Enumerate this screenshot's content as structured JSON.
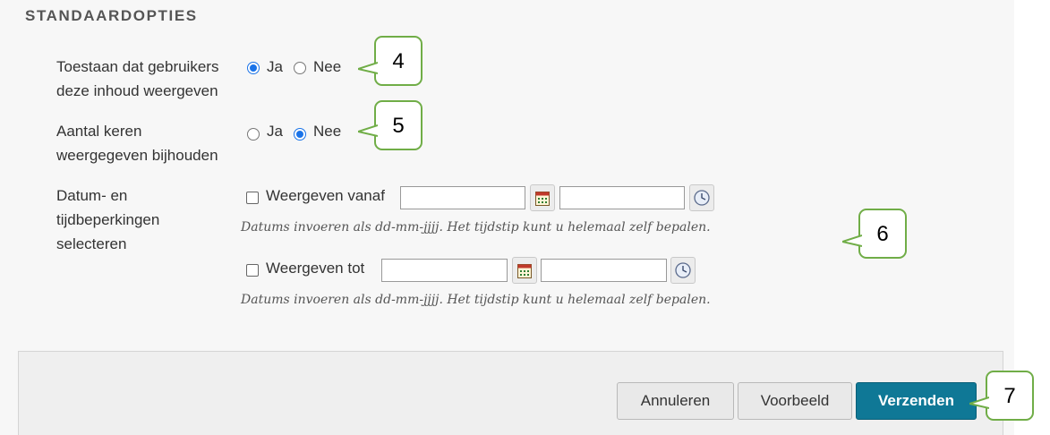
{
  "section": {
    "title": "STANDAARDOPTIES"
  },
  "options": {
    "permit": {
      "label_line1": "Toestaan dat gebruikers",
      "label_line2": "deze inhoud weergeven",
      "yes": "Ja",
      "no": "Nee",
      "selected": "Ja"
    },
    "tracking": {
      "label_line1": "Aantal keren",
      "label_line2": "weergegeven bijhouden",
      "yes": "Ja",
      "no": "Nee",
      "selected": "Nee"
    },
    "dates": {
      "label_line1": "Datum- en",
      "label_line2": "tijdbeperkingen",
      "label_line3": "selecteren",
      "from_label": "Weergeven vanaf",
      "until_label": "Weergeven tot",
      "from_date_value": "",
      "from_time_value": "",
      "until_date_value": "",
      "until_time_value": "",
      "hint": "Datums invoeren als dd-mm-jjjj. Het tijdstip kunt u helemaal zelf bepalen."
    }
  },
  "footer": {
    "cancel": "Annuleren",
    "preview": "Voorbeeld",
    "submit": "Verzenden"
  },
  "callouts": [
    "4",
    "5",
    "6",
    "7"
  ],
  "colors": {
    "accent": "#1a73e8",
    "primary_button": "#0f7896",
    "callout_border": "#70ad47"
  },
  "icons": {
    "calendar": "calendar-icon",
    "clock": "clock-icon"
  }
}
